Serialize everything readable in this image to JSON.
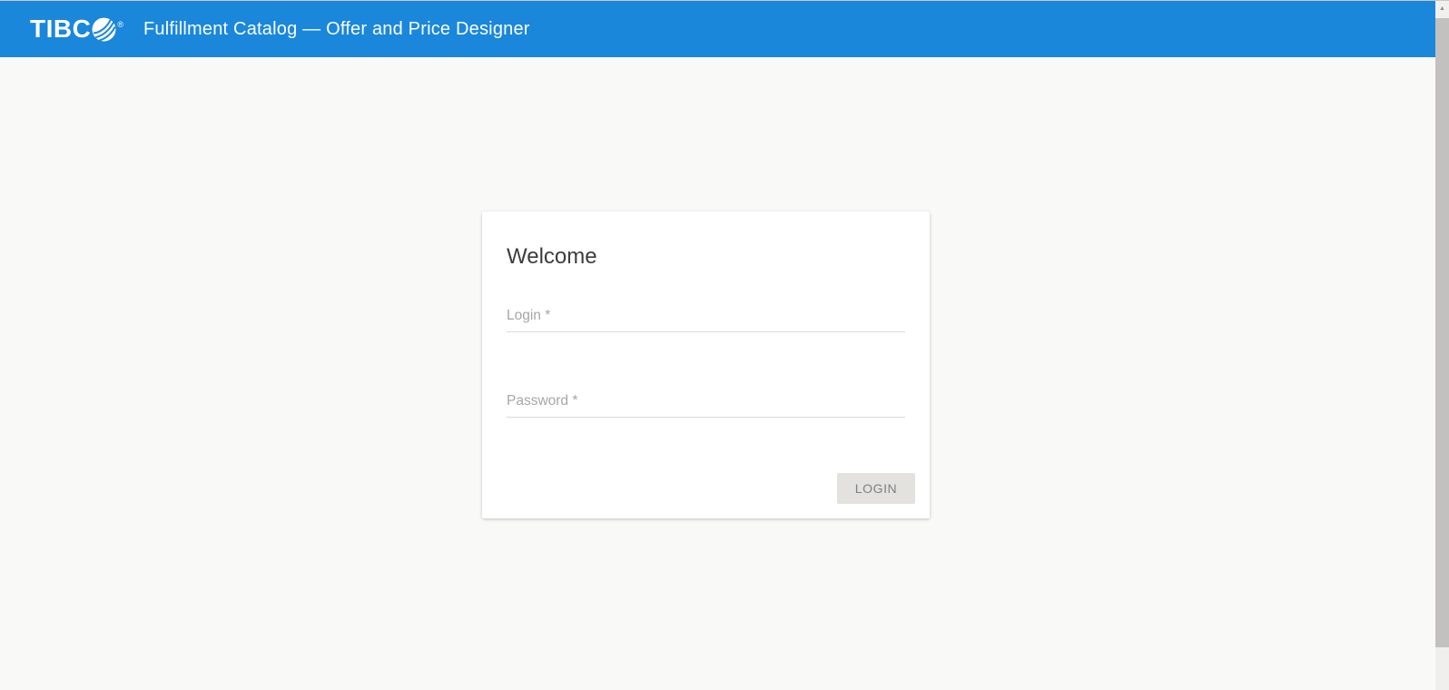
{
  "header": {
    "logo": {
      "text": "TIBC",
      "registered": "®"
    },
    "title": "Fulfillment Catalog — Offer and Price Designer"
  },
  "login_card": {
    "heading": "Welcome",
    "fields": {
      "login": {
        "label": "Login *",
        "value": ""
      },
      "password": {
        "label": "Password *",
        "value": ""
      }
    },
    "submit_label": "LOGIN"
  },
  "scrollbar": {
    "up_arrow": "▲"
  },
  "colors": {
    "header_bg": "#1A87DB",
    "page_bg": "#F9F9F7",
    "card_bg": "#FFFFFF",
    "heading_text": "#3B3C3E",
    "label_text": "#A6A6A6",
    "underline": "#DBDBD9",
    "button_bg": "#E4E2DF",
    "button_text": "#7F7E80",
    "scroll_thumb": "#C2C1BF",
    "scroll_track": "#F0EFED"
  }
}
